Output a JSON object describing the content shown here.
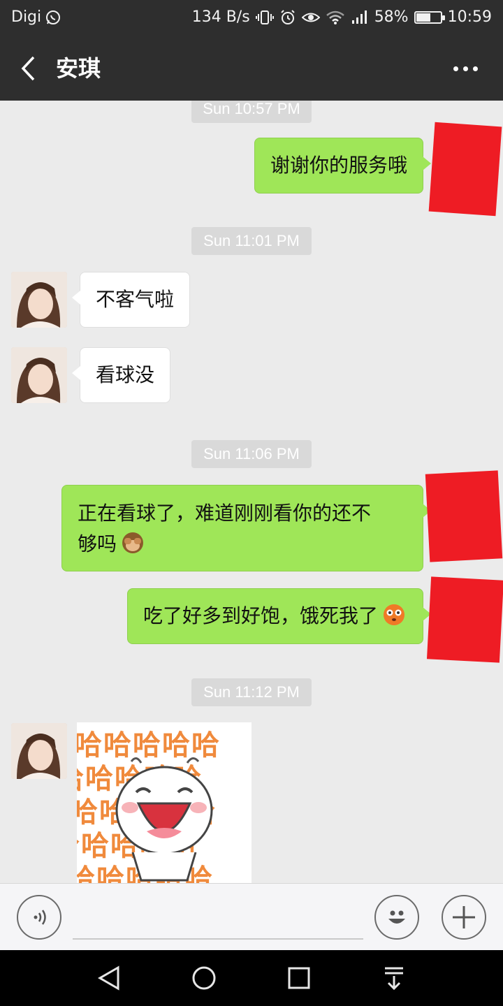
{
  "status_bar": {
    "carrier": "Digi",
    "net_speed": "134 B/s",
    "battery_percent": "58%",
    "battery_level": 0.58,
    "time": "10:59",
    "icons": [
      "whatsapp-icon",
      "vibrate-icon",
      "alarm-icon",
      "eye-icon",
      "wifi-icon",
      "signal-icon",
      "battery-icon"
    ]
  },
  "header": {
    "title": "安琪",
    "back_icon": "chevron-left-icon",
    "more_icon": "more-dots-icon"
  },
  "messages": {
    "ts1": "Sun 10:57 PM",
    "out1": "谢谢你的服务哦",
    "ts2": "Sun 11:01 PM",
    "in1": "不客气啦",
    "in2": "看球没",
    "ts3": "Sun 11:06 PM",
    "out2_line1": "正在看球了，难道刚刚看你的还不",
    "out2_line2": "够吗",
    "out3": "吃了好多到好饱，饿死我了",
    "ts4": "Sun 11:12 PM",
    "sticker_text": "哈哈哈哈哈"
  },
  "input_bar": {
    "voice_icon": "voice-icon",
    "emoji_icon": "smiley-icon",
    "plus_icon": "plus-icon",
    "input_value": ""
  },
  "nav_bar": {
    "icons": [
      "back-triangle-icon",
      "home-circle-icon",
      "recents-square-icon",
      "notification-pull-icon"
    ]
  },
  "colors": {
    "bar_bg": "#2e2e2e",
    "chat_bg": "#ebebeb",
    "out_bubble": "#9fe658",
    "in_bubble": "#ffffff",
    "redaction": "#ee1c24"
  }
}
